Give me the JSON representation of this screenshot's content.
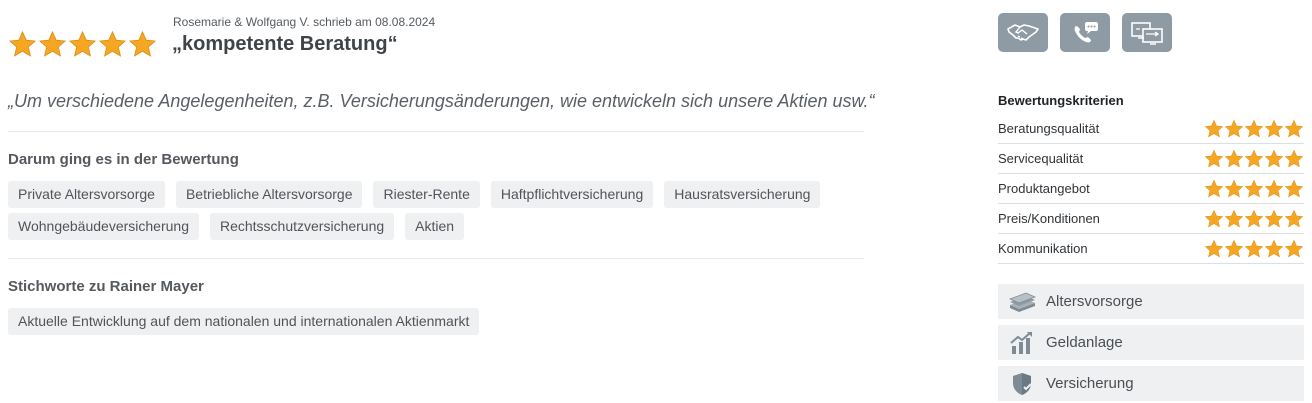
{
  "review": {
    "author_line": "Rosemarie & Wolfgang V. schrieb am 08.08.2024",
    "title": "„kompetente Beratung“",
    "quote": "„Um verschiedene Angelegenheiten, z.B. Versicherungsänderungen, wie entwickeln sich unsere Aktien usw.“",
    "rating": 5,
    "star_color": "#f5a623"
  },
  "topics": {
    "heading": "Darum ging es in der Bewertung",
    "tags": [
      "Private Altersvorsorge",
      "Betriebliche Altersvorsorge",
      "Riester-Rente",
      "Haftpflichtversicherung",
      "Hausratsversicherung",
      "Wohngebäudeversicherung",
      "Rechtsschutzversicherung",
      "Aktien"
    ]
  },
  "keywords": {
    "heading": "Stichworte zu Rainer Mayer",
    "tags": [
      "Aktuelle Entwicklung auf dem nationalen und internationalen Aktienmarkt"
    ]
  },
  "contact_icons": [
    "handshake-icon",
    "phone-chat-icon",
    "screen-share-icon"
  ],
  "criteria": {
    "heading": "Bewertungskriterien",
    "items": [
      {
        "label": "Beratungsqualität",
        "rating": 5
      },
      {
        "label": "Servicequalität",
        "rating": 5
      },
      {
        "label": "Produktangebot",
        "rating": 5
      },
      {
        "label": "Preis/Konditionen",
        "rating": 5
      },
      {
        "label": "Kommunikation",
        "rating": 5
      }
    ]
  },
  "categories": [
    {
      "label": "Altersvorsorge",
      "icon": "money-stack-icon"
    },
    {
      "label": "Geldanlage",
      "icon": "growth-chart-icon"
    },
    {
      "label": "Versicherung",
      "icon": "shield-check-icon"
    }
  ]
}
